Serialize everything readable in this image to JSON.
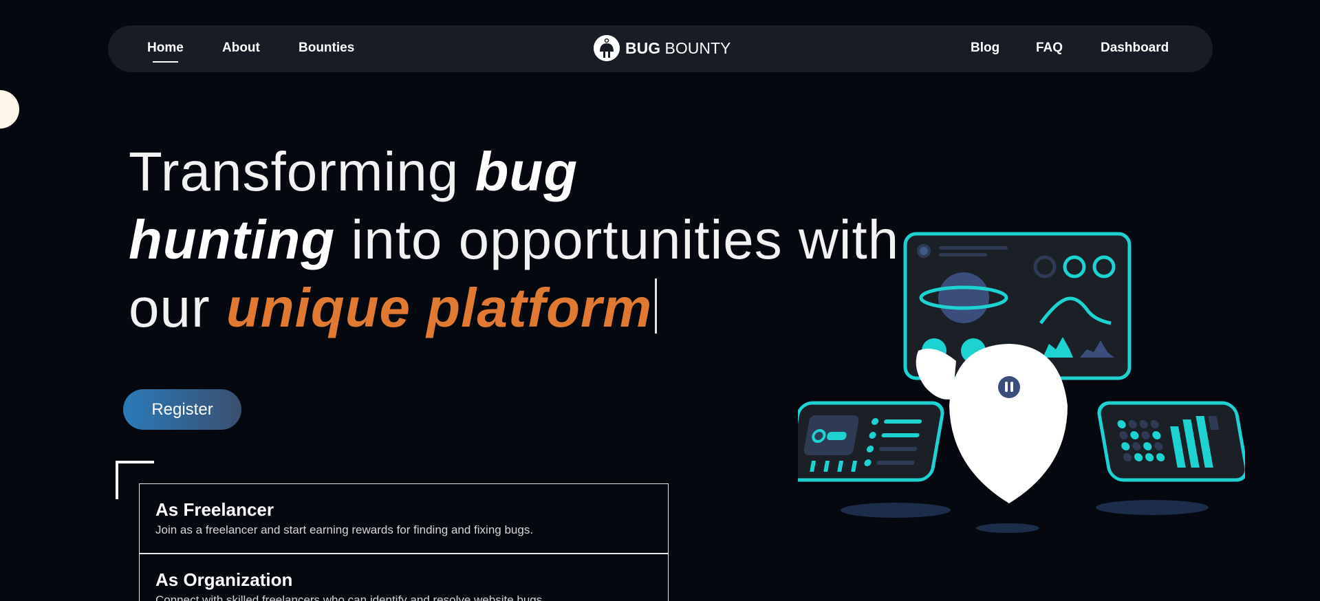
{
  "nav": {
    "left": [
      {
        "label": "Home",
        "active": true
      },
      {
        "label": "About",
        "active": false
      },
      {
        "label": "Bounties",
        "active": false
      }
    ],
    "right": [
      {
        "label": "Blog"
      },
      {
        "label": "FAQ"
      },
      {
        "label": "Dashboard"
      }
    ],
    "logo": {
      "bold": "BUG",
      "light": "BOUNTY"
    }
  },
  "hero": {
    "line1_plain": "Transforming ",
    "line1_em": "bug",
    "line2_em": "hunting",
    "line2_plain": " into opportunities with",
    "line3_plain": "our ",
    "line3_accent": "unique platform"
  },
  "register": {
    "label": "Register"
  },
  "cards": [
    {
      "title": "As Freelancer",
      "desc": "Join as a freelancer and start earning rewards for finding and fixing bugs."
    },
    {
      "title": "As Organization",
      "desc": "Connect with skilled freelancers who can identify and resolve website bugs."
    }
  ],
  "colors": {
    "background": "#05080f",
    "navbar": "#181c24",
    "accent": "#e07a33",
    "cyan": "#1fd2d2",
    "button": "#2a7ab8"
  }
}
